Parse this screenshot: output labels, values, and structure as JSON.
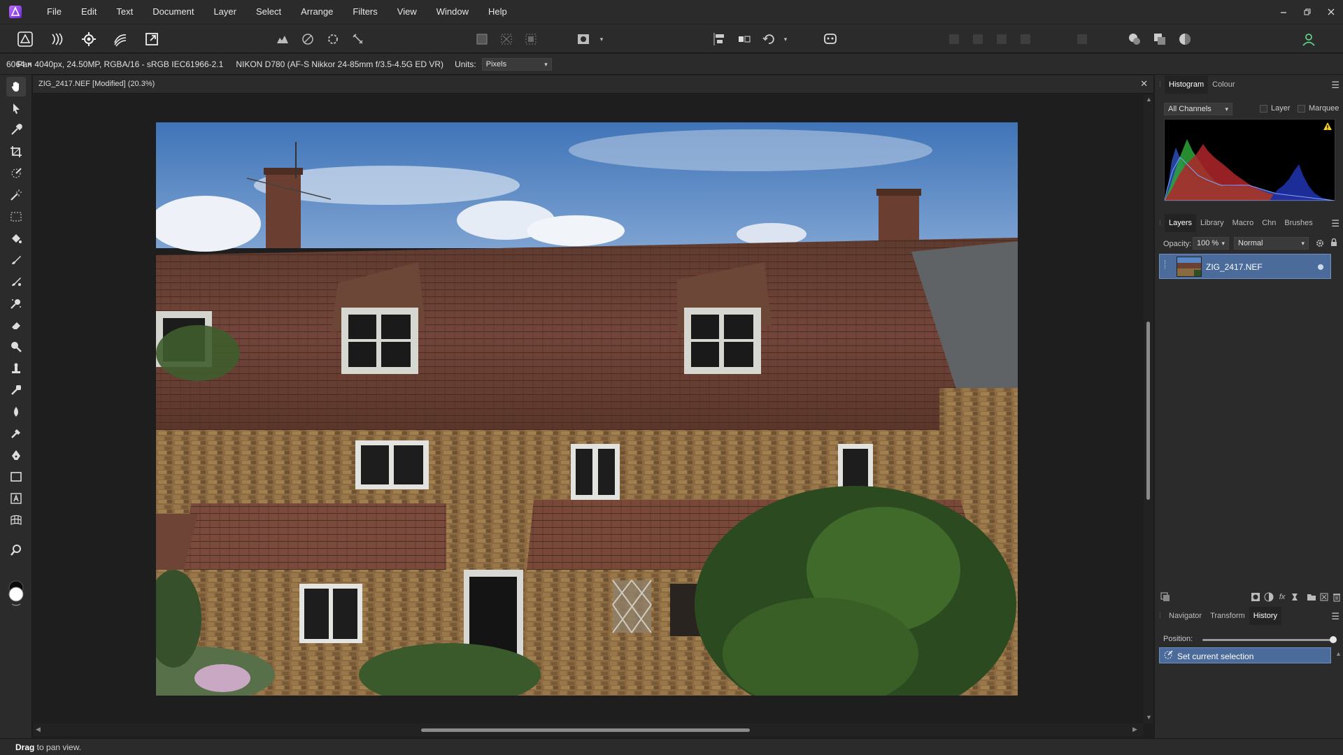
{
  "menubar": {
    "items": [
      "File",
      "Edit",
      "Text",
      "Document",
      "Layer",
      "Select",
      "Arrange",
      "Filters",
      "View",
      "Window",
      "Help"
    ]
  },
  "context": {
    "tool": "Pan",
    "image_info": "6064 × 4040px, 24.50MP, RGBA/16 - sRGB IEC61966-2.1",
    "camera": "NIKON D780 (AF-S Nikkor 24-85mm f/3.5-4.5G ED VR)",
    "units_label": "Units:",
    "units_value": "Pixels"
  },
  "document": {
    "title": "ZIG_2417.NEF [Modified] (20.3%)"
  },
  "histogram_panel": {
    "tabs": [
      "Histogram",
      "Colour"
    ],
    "channel": "All Channels",
    "layer_label": "Layer",
    "marquee_label": "Marquee"
  },
  "layers_panel": {
    "tabs": [
      "Layers",
      "Library",
      "Macro",
      "Chn",
      "Brushes"
    ],
    "opacity_label": "Opacity:",
    "opacity_value": "100 %",
    "blend_mode": "Normal",
    "layer_name": "ZIG_2417.NEF"
  },
  "history_panel": {
    "tabs": [
      "Navigator",
      "Transform",
      "History"
    ],
    "position_label": "Position:",
    "entry": "Set current selection",
    "position_fraction": 1.0
  },
  "status": {
    "bold": "Drag",
    "rest": " to pan view."
  },
  "colors": {
    "selection": "#4b6b9a",
    "panel": "#2b2b2b",
    "canvas": "#1e1e1e"
  }
}
